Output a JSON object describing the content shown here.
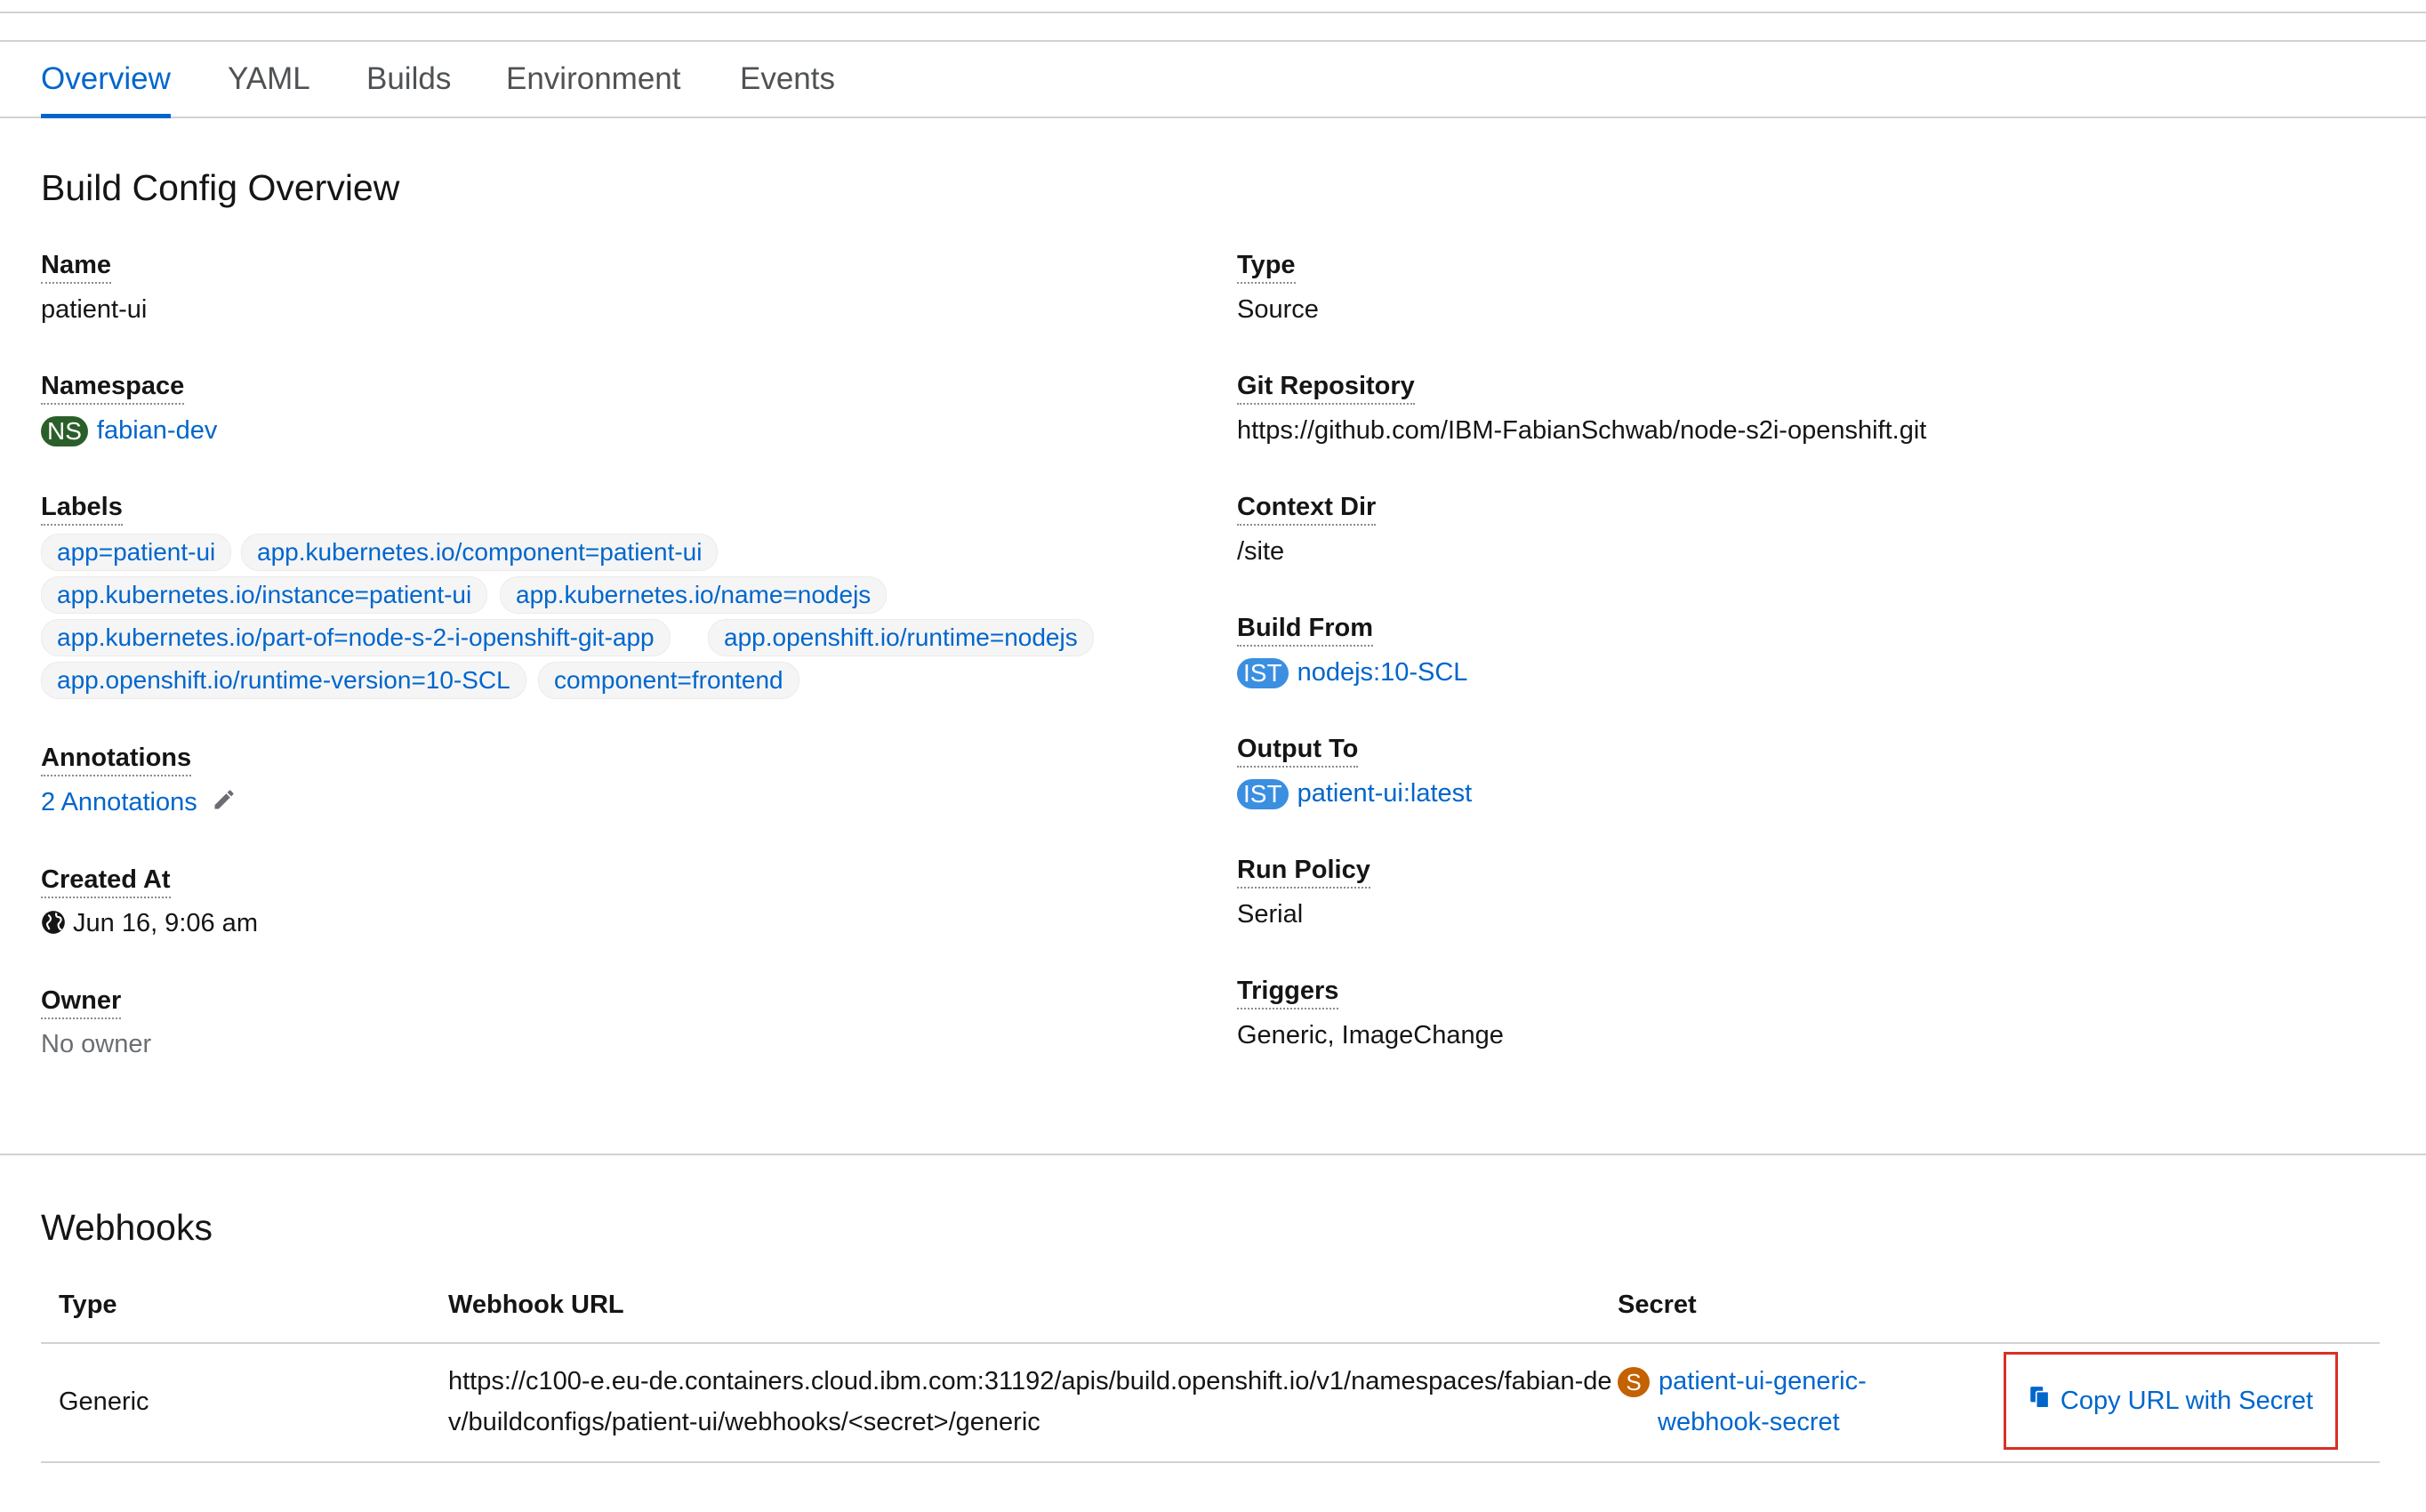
{
  "tabs": [
    "Overview",
    "YAML",
    "Builds",
    "Environment",
    "Events"
  ],
  "overview": {
    "heading": "Build Config Overview",
    "name_label": "Name",
    "name_value": "patient-ui",
    "namespace_label": "Namespace",
    "namespace_badge": "NS",
    "namespace_value": "fabian-dev",
    "labels_label": "Labels",
    "labels": [
      "app=patient-ui",
      "app.kubernetes.io/component=patient-ui",
      "app.kubernetes.io/instance=patient-ui",
      "app.kubernetes.io/name=nodejs",
      "app.kubernetes.io/part-of=node-s-2-i-openshift-git-app",
      "app.openshift.io/runtime=nodejs",
      "app.openshift.io/runtime-version=10-SCL",
      "component=frontend"
    ],
    "annotations_label": "Annotations",
    "annotations_value": "2 Annotations",
    "created_label": "Created At",
    "created_value": "Jun 16, 9:06 am",
    "owner_label": "Owner",
    "owner_value": "No owner",
    "type_label": "Type",
    "type_value": "Source",
    "git_label": "Git Repository",
    "git_value": "https://github.com/IBM-FabianSchwab/node-s2i-openshift.git",
    "context_label": "Context Dir",
    "context_value": "/site",
    "build_from_label": "Build From",
    "build_from_badge": "IST",
    "build_from_value": "nodejs:10-SCL",
    "output_label": "Output To",
    "output_badge": "IST",
    "output_value": "patient-ui:latest",
    "run_policy_label": "Run Policy",
    "run_policy_value": "Serial",
    "triggers_label": "Triggers",
    "triggers_value": "Generic, ImageChange"
  },
  "webhooks": {
    "heading": "Webhooks",
    "columns": [
      "Type",
      "Webhook URL",
      "Secret"
    ],
    "row": {
      "type": "Generic",
      "url_line1": "https://c100-e.eu-de.containers.cloud.ibm.com:31192/apis/build.openshift.io/v1/namespaces/fabian-de",
      "url_line2": "v/buildconfigs/patient-ui/webhooks/<secret>/generic",
      "secret_badge": "S",
      "secret_line1": "patient-ui-generic-",
      "secret_line2": "webhook-secret",
      "action": "Copy URL with Secret"
    }
  },
  "colors": {
    "link": "#0066cc",
    "highlight_border": "#d93025",
    "ns_badge": "#2b5f2a",
    "ist_badge": "#3b8fe0",
    "secret_badge": "#c46100"
  }
}
